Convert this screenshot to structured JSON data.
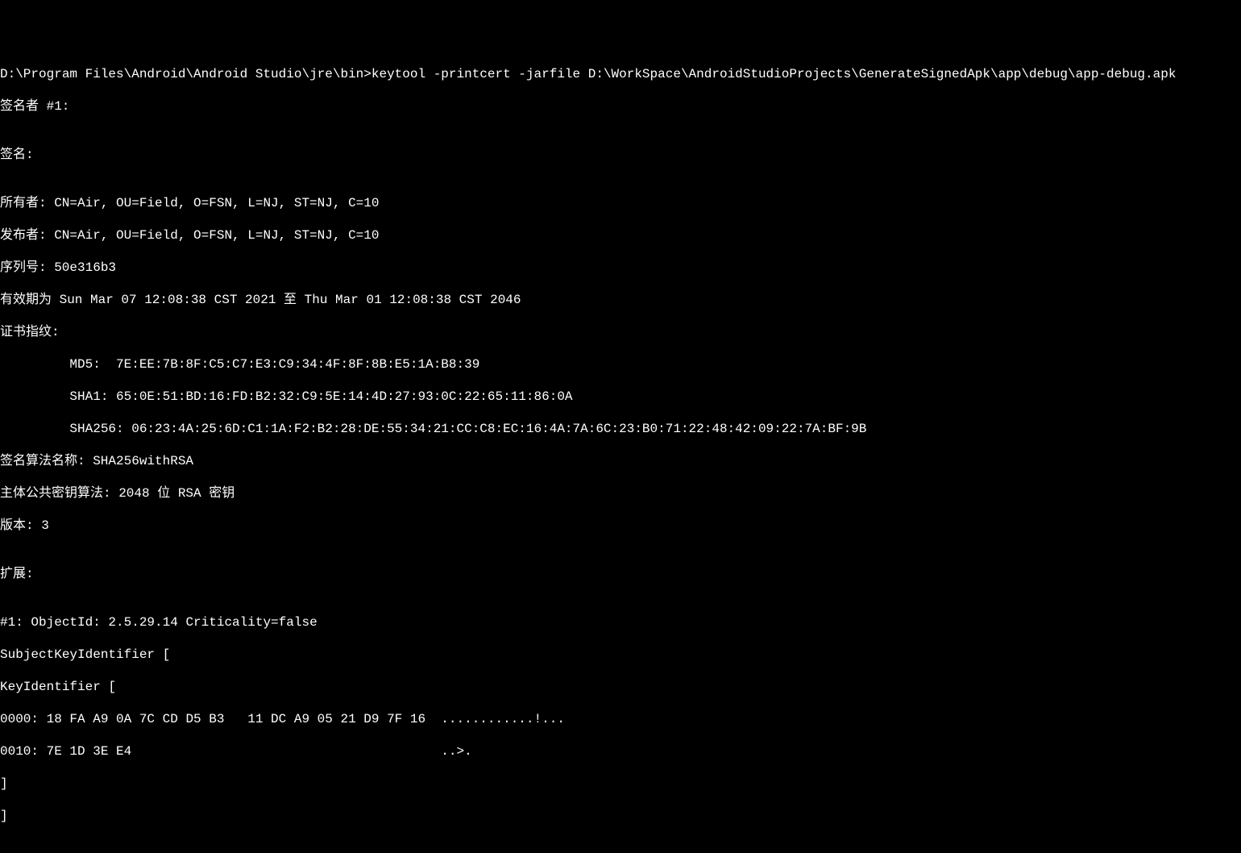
{
  "prompt": {
    "path": "D:\\Program Files\\Android\\Android Studio\\jre\\bin>",
    "command": "keytool -printcert -jarfile D:\\WorkSpace\\AndroidStudioProjects\\GenerateSignedApk\\app\\debug\\app-debug.apk"
  },
  "signer_header": "签名者 #1:",
  "blank": "",
  "signature_label": "签名:",
  "owner": "所有者: CN=Air, OU=Field, O=FSN, L=NJ, ST=NJ, C=10",
  "issuer": "发布者: CN=Air, OU=Field, O=FSN, L=NJ, ST=NJ, C=10",
  "serial": "序列号: 50e316b3",
  "validity": "有效期为 Sun Mar 07 12:08:38 CST 2021 至 Thu Mar 01 12:08:38 CST 2046",
  "fingerprints_label": "证书指纹:",
  "md5": "         MD5:  7E:EE:7B:8F:C5:C7:E3:C9:34:4F:8F:8B:E5:1A:B8:39",
  "sha1": "         SHA1: 65:0E:51:BD:16:FD:B2:32:C9:5E:14:4D:27:93:0C:22:65:11:86:0A",
  "sha256": "         SHA256: 06:23:4A:25:6D:C1:1A:F2:B2:28:DE:55:34:21:CC:C8:EC:16:4A:7A:6C:23:B0:71:22:48:42:09:22:7A:BF:9B",
  "sig_algo": "签名算法名称: SHA256withRSA",
  "pubkey_algo": "主体公共密钥算法: 2048 位 RSA 密钥",
  "version": "版本: 3",
  "extensions_label": "扩展:",
  "ext_header": "#1: ObjectId: 2.5.29.14 Criticality=false",
  "ski_label": "SubjectKeyIdentifier [",
  "ki_label": "KeyIdentifier [",
  "hex_row_0": "0000: 18 FA A9 0A 7C CD D5 B3   11 DC A9 05 21 D9 7F 16  ............!...",
  "hex_row_1": "0010: 7E 1D 3E E4                                        ..>.",
  "close_1": "]",
  "close_2": "]"
}
